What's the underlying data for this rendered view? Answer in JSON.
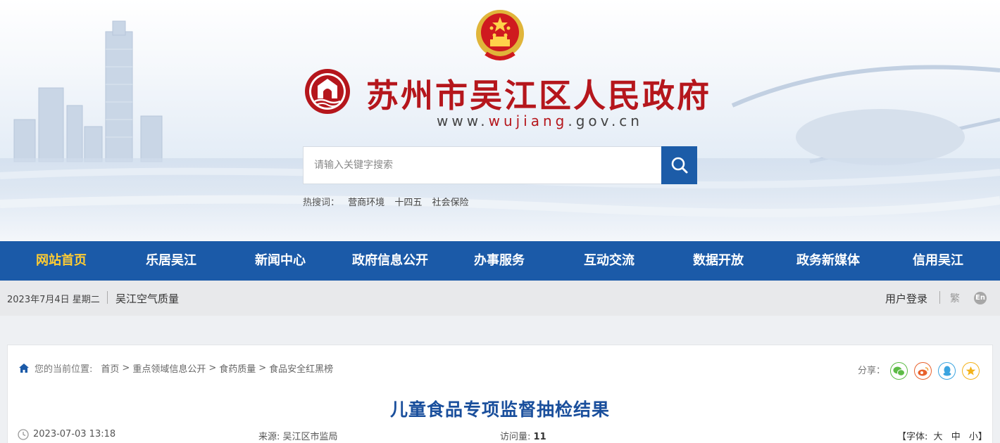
{
  "header": {
    "site_title": "苏州市吴江区人民政府",
    "url_prefix": "www.",
    "url_domain": "wujiang",
    "url_suffix": ".gov.cn",
    "brand_red": "#b5161c",
    "brand_blue": "#1b5aa8"
  },
  "search": {
    "placeholder": "请输入关键字搜索",
    "value": "",
    "button_icon": "search-icon",
    "hot_label": "热搜词：",
    "hot_words": [
      "营商环境",
      "十四五",
      "社会保险"
    ]
  },
  "nav": {
    "items": [
      "网站首页",
      "乐居吴江",
      "新闻中心",
      "政府信息公开",
      "办事服务",
      "互动交流",
      "数据开放",
      "政务新媒体",
      "信用吴江"
    ],
    "active_color": "#ffcc33"
  },
  "subbar": {
    "date": "2023年7月4日 星期二",
    "air_quality": "吴江空气质量",
    "login": "用户登录",
    "traditional": "繁",
    "english": "En"
  },
  "breadcrumb": {
    "label": "您的当前位置:",
    "items": [
      "首页",
      "重点领域信息公开",
      "食药质量",
      "食品安全红黑榜"
    ],
    "separator": ">"
  },
  "share": {
    "label": "分享：",
    "icons": [
      "wechat-icon",
      "weibo-icon",
      "qq-icon",
      "qzone-icon"
    ]
  },
  "article": {
    "title": "儿童食品专项监督抽检结果",
    "datetime": "2023-07-03 13:18",
    "source_label": "来源:",
    "source": "吴江区市监局",
    "views_label": "访问量:",
    "views": "11",
    "font_label": "【字体:",
    "font_large": "大",
    "font_medium": "中",
    "font_small": "小】"
  }
}
